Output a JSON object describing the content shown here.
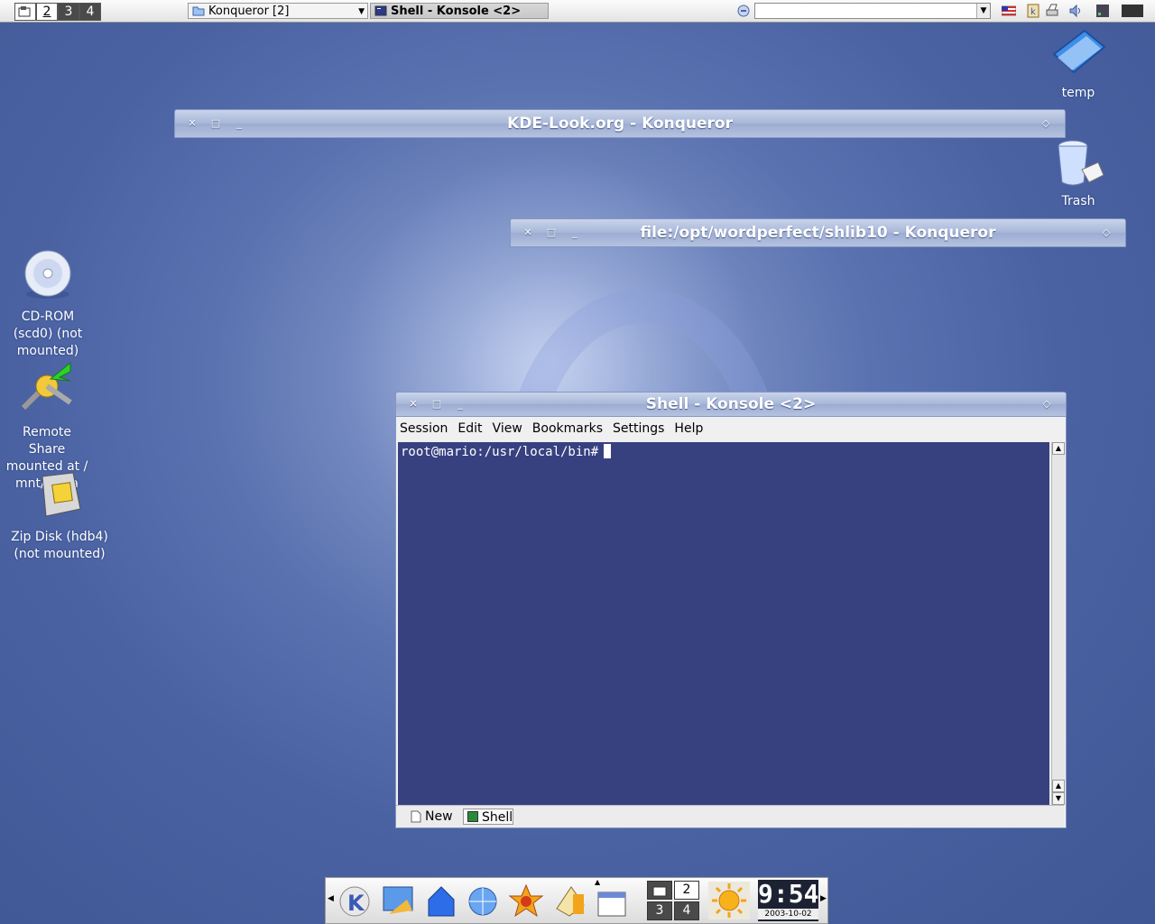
{
  "top_panel": {
    "pager": [
      "1",
      "2",
      "3",
      "4"
    ],
    "tasks": [
      {
        "label": "Konqueror [2]"
      },
      {
        "label": "Shell - Konsole <2>"
      }
    ],
    "url_combo_value": ""
  },
  "desktop_icons": {
    "temp": "temp",
    "trash": "Trash",
    "cdrom": [
      "CD-ROM",
      "(scd0) (not",
      "mounted)"
    ],
    "remote": [
      "Remote Share",
      "mounted at /",
      "mnt/zelda"
    ],
    "zip": [
      "Zip Disk (hdb4)",
      "(not mounted)"
    ]
  },
  "windows": {
    "konq1_title": "KDE-Look.org - Konqueror",
    "konq2_title": "file:/opt/wordperfect/shlib10 - Konqueror",
    "konsole_title": "Shell - Konsole <2>"
  },
  "konsole": {
    "menu": [
      "Session",
      "Edit",
      "View",
      "Bookmarks",
      "Settings",
      "Help"
    ],
    "prompt": "root@mario:/usr/local/bin#",
    "tabs": {
      "new": "New",
      "shell": "Shell"
    }
  },
  "bottom_panel": {
    "pager": [
      "1",
      "2",
      "3",
      "4"
    ],
    "clock_time": "9:54",
    "clock_date": "2003-10-02"
  },
  "colors": {
    "desktop": "#4a62a2",
    "terminal_bg": "#1a246e",
    "titlebar": "#a7b6d8"
  }
}
